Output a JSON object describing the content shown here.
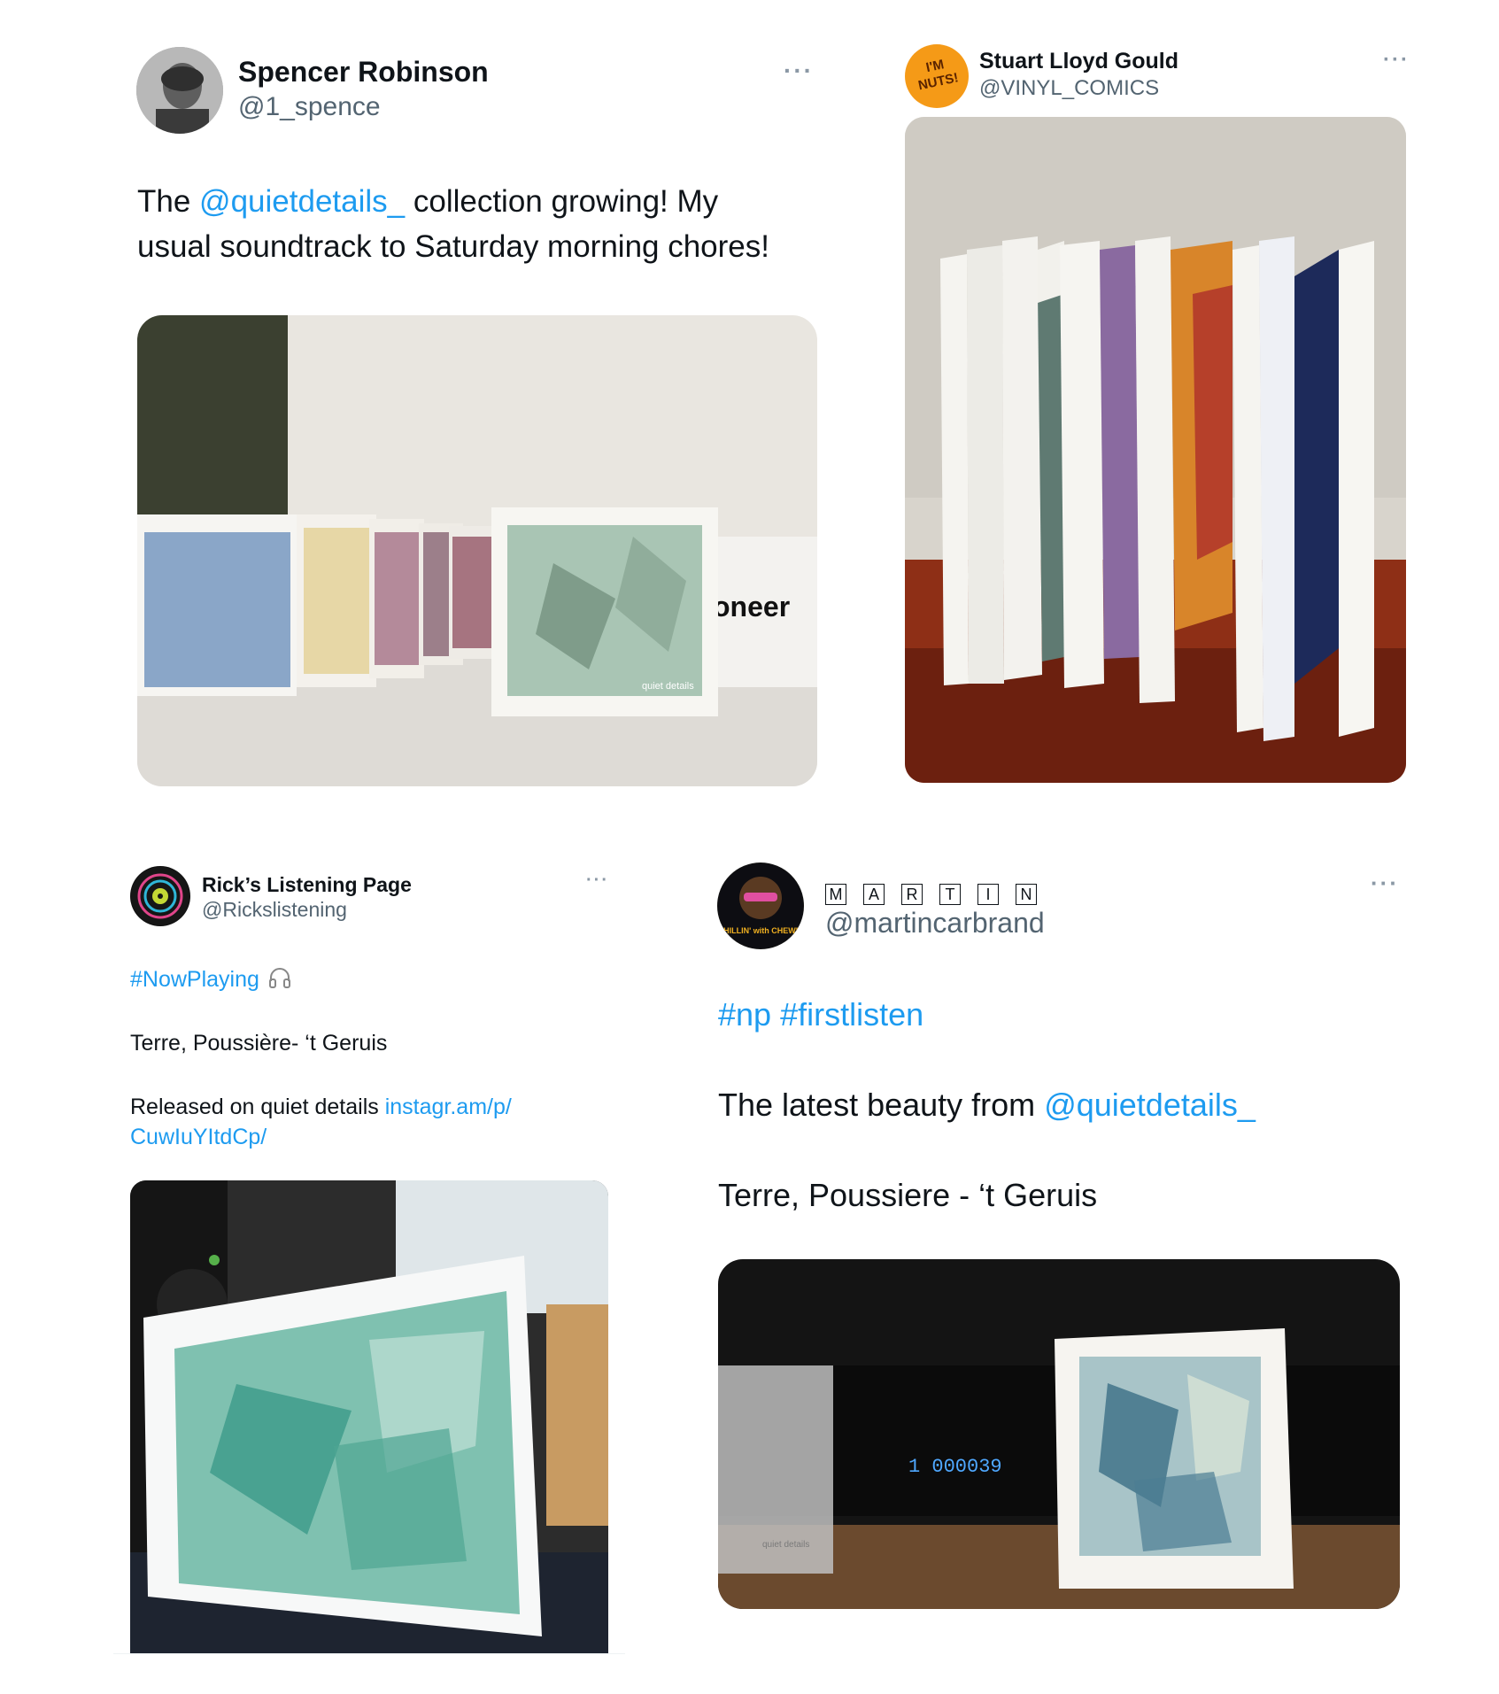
{
  "tweets": [
    {
      "name": "Spencer Robinson",
      "handle": "@1_spence",
      "more": "···",
      "line1_pre": "The ",
      "line1_link": "@quietdetails_",
      "line1_post": " collection growing! My",
      "line2": "usual soundtrack to Saturday morning chores!",
      "photo_caption": "quiet details"
    },
    {
      "name": "Stuart Lloyd Gould",
      "handle": "@VINYL_COMICS",
      "avatar_text": "I'M NUTS!",
      "more": "···"
    },
    {
      "name": "Rick’s Listening Page",
      "handle": "@Rickslistening",
      "more": "···",
      "hashtag": "#NowPlaying",
      "line1": "Terre, Poussière- ‘t Geruis",
      "line2_pre": "Released on quiet details ",
      "line2_link": "instagr.am/p/",
      "line3_link": "CuwIuYItdCp/"
    },
    {
      "name_letters": [
        "M",
        "A",
        "R",
        "T",
        "I",
        "N"
      ],
      "handle": "@martincarbrand",
      "more": "···",
      "avatar_text": "CHILLIN' with CHEWIE",
      "hashtags": "#np #firstlisten",
      "line1_pre": "The latest beauty from ",
      "line1_link": "@quietdetails_",
      "line2": "Terre, Poussiere - ‘t Geruis",
      "display_counter": "1 000039",
      "sleeve_text": "quiet details"
    }
  ],
  "colors": {
    "link": "#1d9bf0",
    "text": "#0f1419",
    "muted": "#536471"
  }
}
